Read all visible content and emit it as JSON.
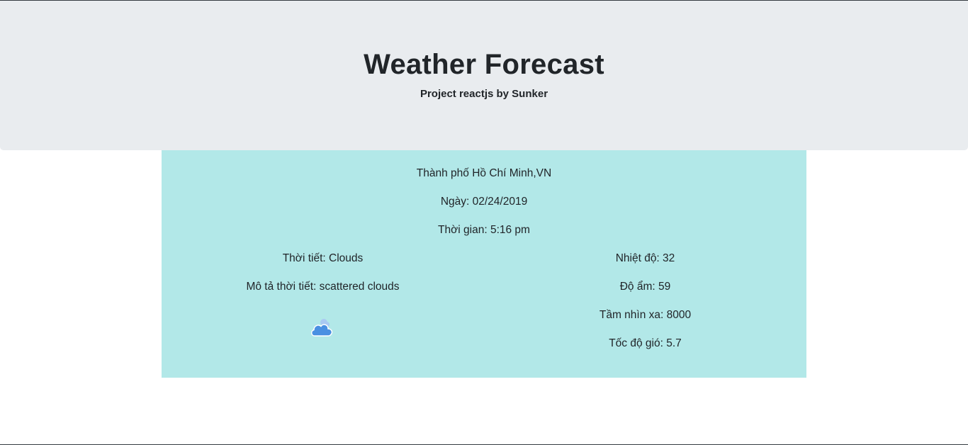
{
  "header": {
    "title": "Weather Forecast",
    "subtitle": "Project reactjs by Sunker"
  },
  "weather": {
    "city": "Thành phố Hồ Chí Minh,VN",
    "date": "Ngày: 02/24/2019",
    "time": "Thời gian: 5:16 pm",
    "condition": "Thời tiết: Clouds",
    "description": "Mô tả thời tiết: scattered clouds",
    "icon": "cloud-icon",
    "temperature": "Nhiệt độ: 32",
    "humidity": "Độ ẩm: 59",
    "visibility": "Tầm nhìn xa: 8000",
    "wind_speed": "Tốc độ gió: 5.7"
  },
  "colors": {
    "header_bg": "#e9ecef",
    "panel_bg": "#b2e8e8",
    "icon_blue": "#4a90e2"
  }
}
